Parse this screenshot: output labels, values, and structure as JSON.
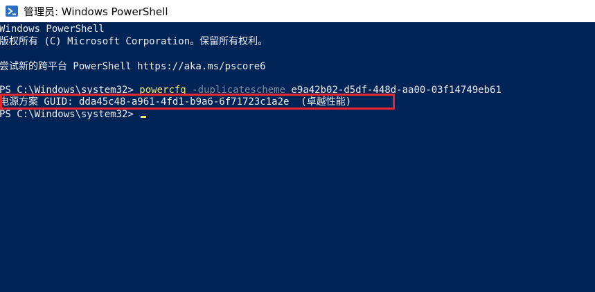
{
  "window": {
    "title": "管理员: Windows PowerShell",
    "icon": "powershell-icon"
  },
  "console": {
    "lines": {
      "banner_title": "Windows PowerShell",
      "copyright": "版权所有 (C) Microsoft Corporation。保留所有权利。",
      "try_new": "尝试新的跨平台 PowerShell https://aka.ms/pscore6",
      "prompt1": "PS C:\\Windows\\system32> ",
      "cmd_name": "powercfg",
      "cmd_param": " -duplicatescheme",
      "cmd_arg": " e9a42b02-d5df-448d-aa00-03f14749eb61",
      "result": "电源方案 GUID: dda45c48-a961-4fd1-b9a6-6f71723c1a2e  (卓越性能)",
      "prompt2": "PS C:\\Windows\\system32> "
    },
    "colors": {
      "background": "#012456",
      "text": "#eeedf0",
      "command": "#f2e86a",
      "parameter": "#7f8aa0",
      "highlight": "#e0282e"
    }
  }
}
